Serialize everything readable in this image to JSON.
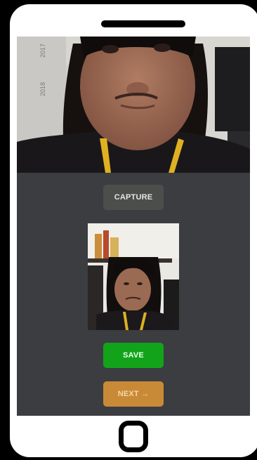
{
  "buttons": {
    "capture_label": "CAPTURE",
    "save_label": "SAVE",
    "next_label": "NEXT →"
  },
  "colors": {
    "screen_background": "#3b3d41",
    "capture_button": "#4c4e4c",
    "save_button": "#12a31a",
    "next_button": "#c98a37"
  },
  "icons": {
    "home_button": "rounded-square-icon"
  }
}
